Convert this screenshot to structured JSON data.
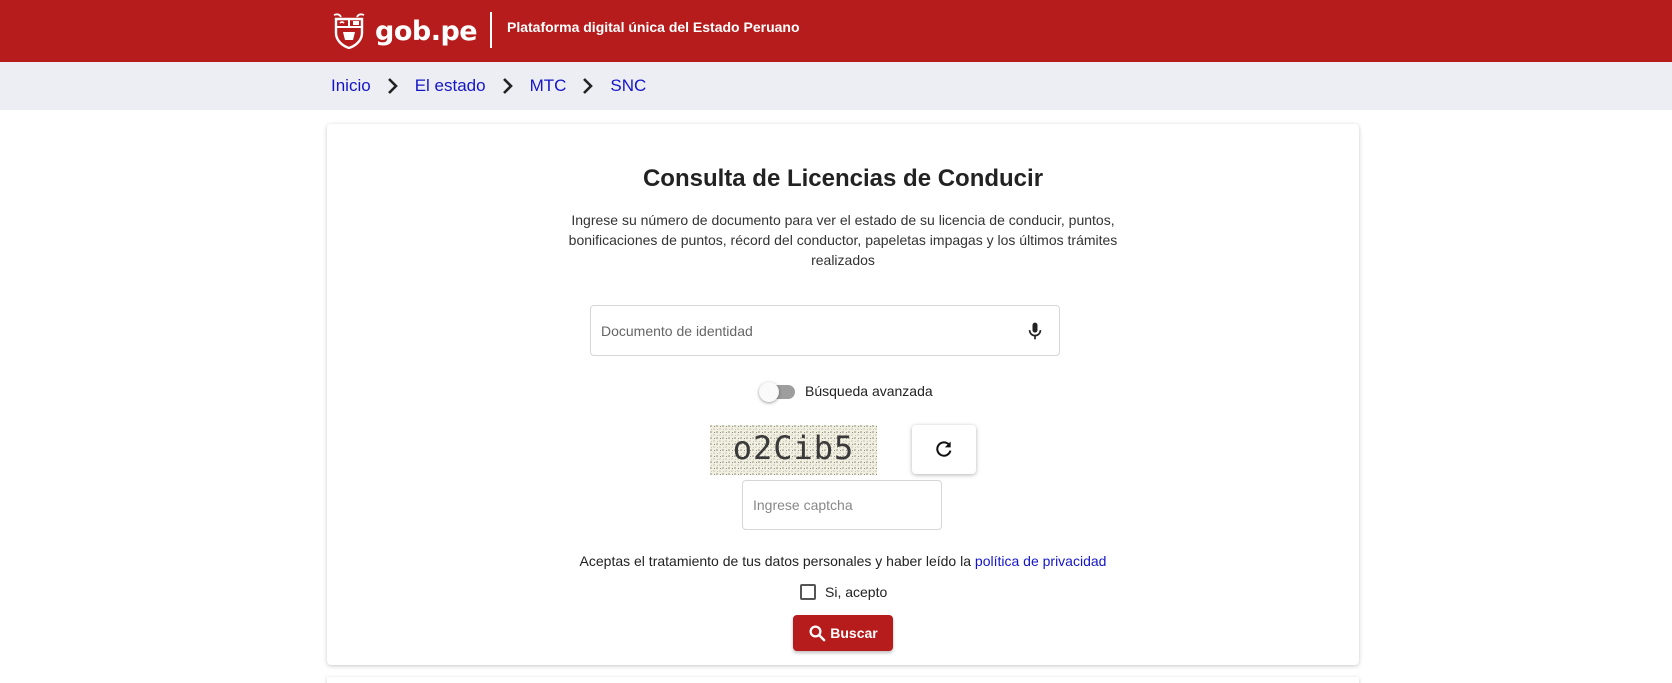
{
  "header": {
    "logo_text": "gob.pe",
    "tagline": "Plataforma digital única del Estado Peruano",
    "bg_color": "#b71c1c"
  },
  "breadcrumb": [
    {
      "label": "Inicio"
    },
    {
      "label": "El estado"
    },
    {
      "label": "MTC"
    },
    {
      "label": "SNC"
    }
  ],
  "main": {
    "title": "Consulta de Licencias de Conducir",
    "description": "Ingrese su número de documento para ver el estado de su licencia de conducir, puntos, bonificaciones de puntos, récord del conductor, papeletas impagas y los últimos trámites realizados",
    "document_field": {
      "placeholder": "Documento de identidad",
      "value": "",
      "icon": "microphone-icon"
    },
    "advanced_search": {
      "label": "Búsqueda avanzada",
      "enabled": false
    },
    "captcha": {
      "text": "o2Cib5",
      "refresh_icon": "refresh-icon"
    },
    "captcha_field": {
      "placeholder": "Ingrese captcha",
      "value": ""
    },
    "consent": {
      "text": "Aceptas el tratamiento de tus datos personales y haber leído la ",
      "link": "política de privacidad"
    },
    "accept_checkbox": {
      "label": "Si, acepto",
      "checked": false
    },
    "search_button": {
      "label": "Buscar",
      "icon": "search-icon",
      "color": "#b71c1c"
    }
  }
}
